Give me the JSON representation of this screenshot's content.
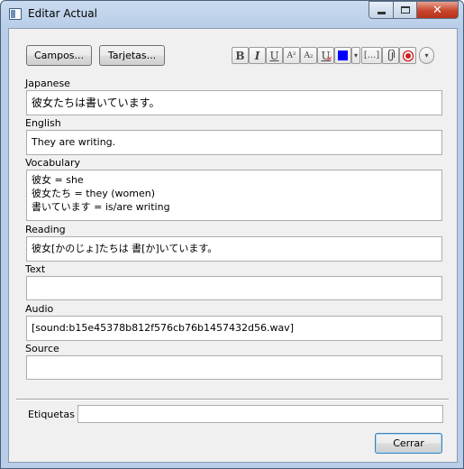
{
  "window": {
    "title": "Editar Actual",
    "close_glyph": "✕"
  },
  "buttons": {
    "fields": "Campos...",
    "cards": "Tarjetas...",
    "close": "Cerrar"
  },
  "toolbar": {
    "bold": "B",
    "italic": "I",
    "underline": "U",
    "superscript": "A²",
    "subscript": "A₂",
    "clear_format": "U",
    "color_dropdown": "▾",
    "cloze": "[...]",
    "attach": "⊘",
    "record": "●",
    "more": "▾",
    "color_swatch": "#0000ff",
    "record_color": "#cc1f1f"
  },
  "fields": [
    {
      "label": "Japanese",
      "value": "彼女たちは書いています。"
    },
    {
      "label": "English",
      "value": "They are writing."
    },
    {
      "label": "Vocabulary",
      "value": "彼女 = she\n彼女たち = they (women)\n書いています = is/are writing"
    },
    {
      "label": "Reading",
      "value": "彼女[かのじょ]たちは 書[か]いています。"
    },
    {
      "label": "Text",
      "value": ""
    },
    {
      "label": "Audio",
      "value": "[sound:b15e45378b812f576cb76b1457432d56.wav]"
    },
    {
      "label": "Source",
      "value": ""
    }
  ],
  "tags": {
    "label": "Etiquetas",
    "value": ""
  }
}
